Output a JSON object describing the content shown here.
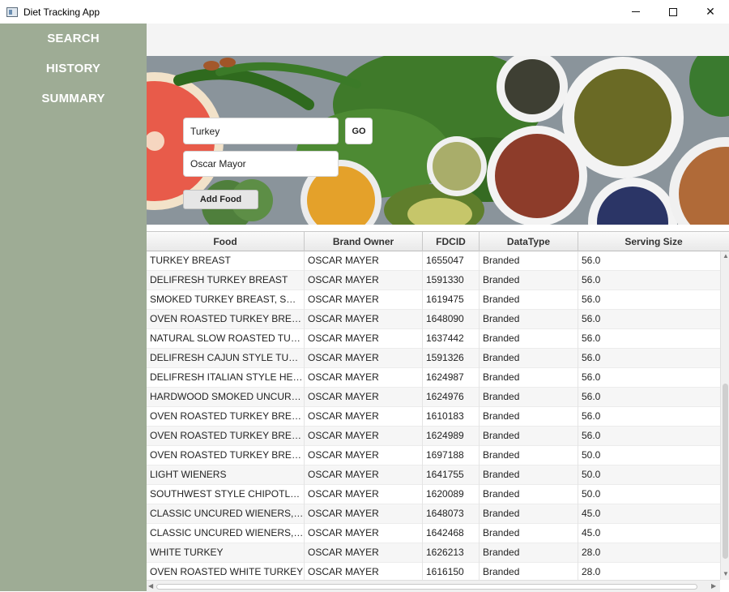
{
  "window": {
    "title": "Diet Tracking App"
  },
  "sidebar": {
    "items": [
      {
        "label": "SEARCH"
      },
      {
        "label": "HISTORY"
      },
      {
        "label": "SUMMARY"
      }
    ]
  },
  "search": {
    "food_value": "Turkey",
    "brand_value": "Oscar Mayor",
    "go_label": "GO",
    "add_label": "Add Food"
  },
  "table": {
    "columns": [
      "Food",
      "Brand Owner",
      "FDCID",
      "DataType",
      "Serving Size"
    ],
    "rows": [
      [
        "TURKEY BREAST",
        "OSCAR MAYER",
        "1655047",
        "Branded",
        "56.0"
      ],
      [
        "DELIFRESH TURKEY BREAST",
        "OSCAR MAYER",
        "1591330",
        "Branded",
        "56.0"
      ],
      [
        "SMOKED TURKEY BREAST, SMOK...",
        "OSCAR MAYER",
        "1619475",
        "Branded",
        "56.0"
      ],
      [
        "OVEN ROASTED TURKEY BREAST",
        "OSCAR MAYER",
        "1648090",
        "Branded",
        "56.0"
      ],
      [
        "NATURAL SLOW ROASTED TURK...",
        "OSCAR MAYER",
        "1637442",
        "Branded",
        "56.0"
      ],
      [
        "DELIFRESH CAJUN STYLE TURKEY...",
        "OSCAR MAYER",
        "1591326",
        "Branded",
        "56.0"
      ],
      [
        "DELIFRESH ITALIAN STYLE HERB ...",
        "OSCAR MAYER",
        "1624987",
        "Branded",
        "56.0"
      ],
      [
        "HARDWOOD SMOKED UNCURE...",
        "OSCAR MAYER",
        "1624976",
        "Branded",
        "56.0"
      ],
      [
        "OVEN ROASTED TURKEY BREAST ...",
        "OSCAR MAYER",
        "1610183",
        "Branded",
        "56.0"
      ],
      [
        "OVEN ROASTED TURKEY BREAST,...",
        "OSCAR MAYER",
        "1624989",
        "Branded",
        "56.0"
      ],
      [
        "OVEN ROASTED TURKEY BREAST ...",
        "OSCAR MAYER",
        "1697188",
        "Branded",
        "50.0"
      ],
      [
        "LIGHT WIENERS",
        "OSCAR MAYER",
        "1641755",
        "Branded",
        "50.0"
      ],
      [
        "SOUTHWEST STYLE CHIPOTLE D...",
        "OSCAR MAYER",
        "1620089",
        "Branded",
        "50.0"
      ],
      [
        "CLASSIC UNCURED WIENERS, CL...",
        "OSCAR MAYER",
        "1648073",
        "Branded",
        "45.0"
      ],
      [
        "CLASSIC UNCURED WIENERS, CL...",
        "OSCAR MAYER",
        "1642468",
        "Branded",
        "45.0"
      ],
      [
        "WHITE TURKEY",
        "OSCAR MAYER",
        "1626213",
        "Branded",
        "28.0"
      ],
      [
        "OVEN ROASTED WHITE TURKEY",
        "OSCAR MAYER",
        "1616150",
        "Branded",
        "28.0"
      ]
    ]
  },
  "colors": {
    "sidebar": "#9eac95",
    "sidebar_text": "#ffffff"
  },
  "icons": [
    "app-icon",
    "minimize-icon",
    "maximize-icon",
    "close-icon",
    "scroll-up-icon",
    "scroll-down-icon",
    "scroll-left-icon",
    "scroll-right-icon"
  ]
}
